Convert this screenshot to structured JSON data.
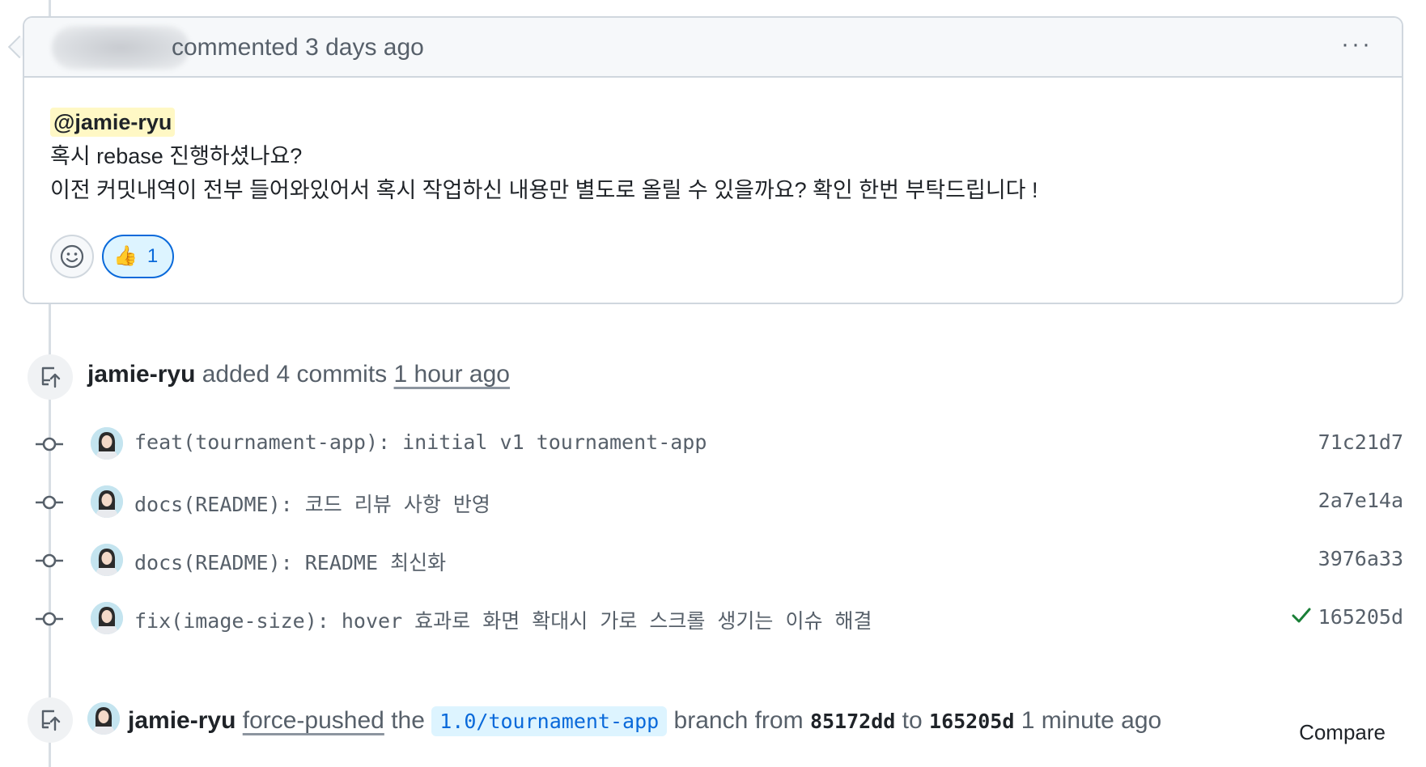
{
  "comment": {
    "meta": "commented 3 days ago",
    "menu": "···",
    "mention": "@jamie-ryu",
    "line1": "혹시 rebase 진행하셨나요?",
    "line2": "이전 커밋내역이 전부 들어와있어서 혹시 작업하신 내용만 별도로 올릴 수 있을까요? 확인 한번 부탁드립니다 !",
    "reaction": {
      "emoji": "👍",
      "count": "1"
    }
  },
  "commits_event": {
    "actor": "jamie-ryu",
    "action": "added 4 commits",
    "time": "1 hour ago"
  },
  "commits": [
    {
      "message": "feat(tournament-app): initial v1 tournament-app",
      "sha": "71c21d7",
      "checked": false
    },
    {
      "message": "docs(README): 코드 리뷰 사항 반영",
      "sha": "2a7e14a",
      "checked": false
    },
    {
      "message": "docs(README): README 최신화",
      "sha": "3976a33",
      "checked": false
    },
    {
      "message": "fix(image-size): hover 효과로 화면 확대시 가로 스크롤 생기는 이슈 해결",
      "sha": "165205d",
      "checked": true
    }
  ],
  "force_push": {
    "actor": "jamie-ryu",
    "action": "force-pushed",
    "the": "the",
    "branch": "1.0/tournament-app",
    "branch_from": "branch from",
    "from_sha": "85172dd",
    "to": "to",
    "to_sha": "165205d",
    "time": "1 minute ago",
    "compare": "Compare"
  },
  "colors": {
    "accent": "#0969da",
    "mention_bg": "#fff8c5",
    "success": "#1a7f37",
    "muted": "#57606a",
    "border": "#d0d7de"
  }
}
